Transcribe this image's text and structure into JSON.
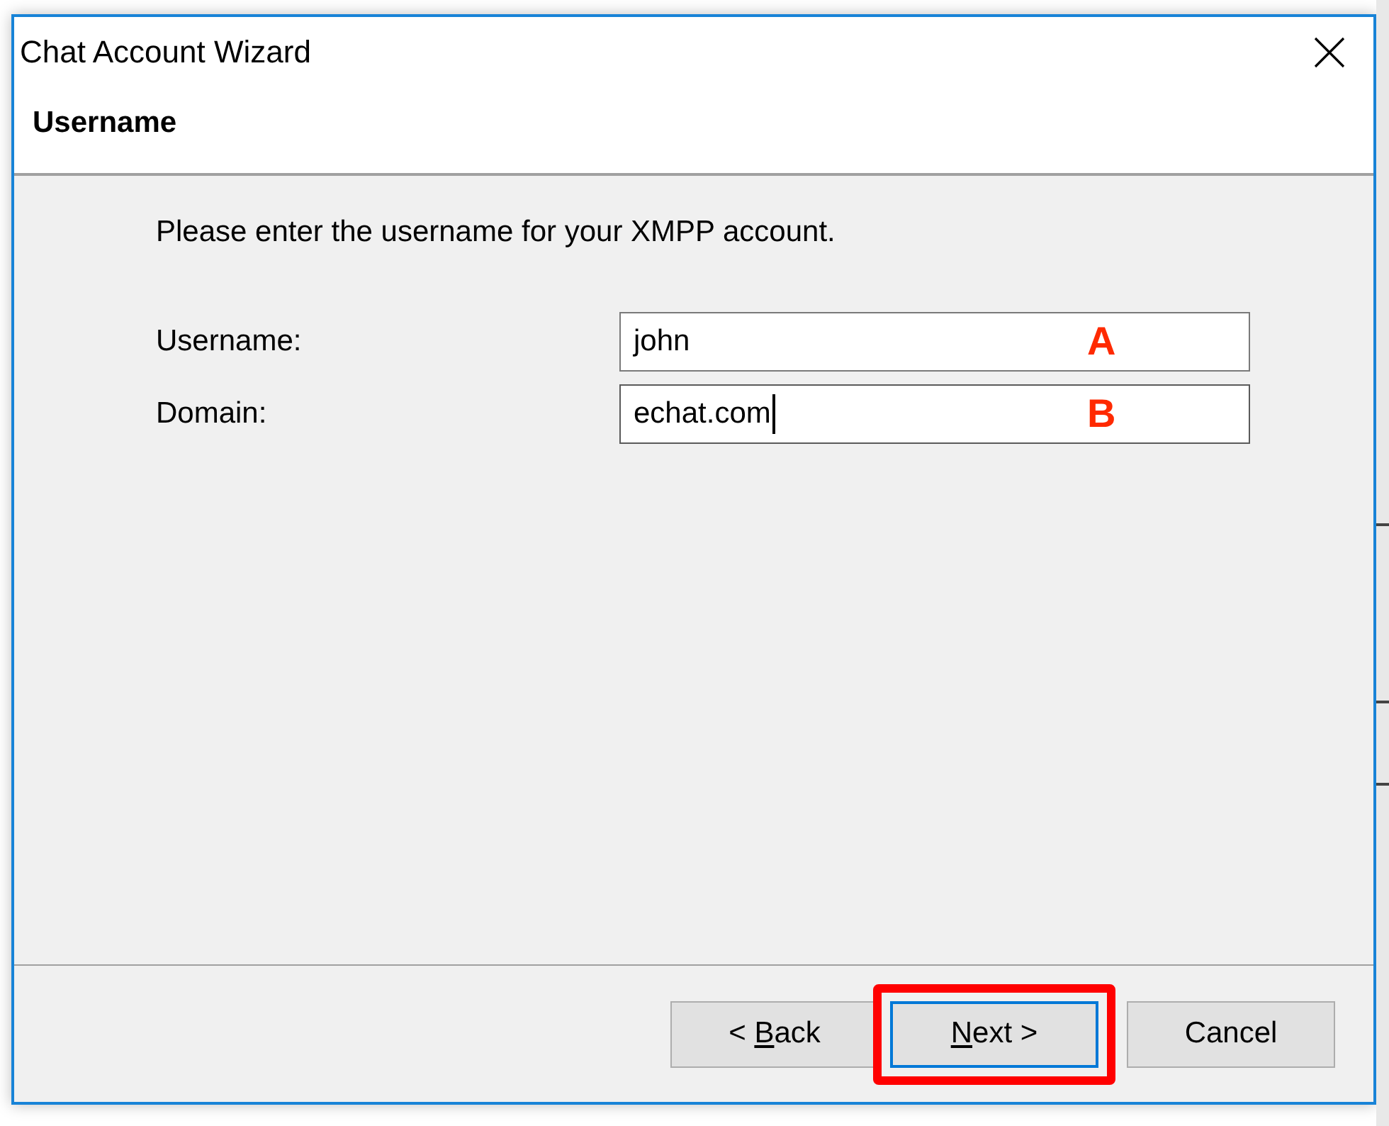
{
  "window": {
    "title": "Chat Account Wizard"
  },
  "page_heading": "Username",
  "instruction": "Please enter the username for your XMPP account.",
  "fields": [
    {
      "label": "Username:",
      "value": "john",
      "focused": false,
      "annotation": "A"
    },
    {
      "label": "Domain:",
      "value": "echat.com",
      "focused": true,
      "annotation": "B"
    }
  ],
  "buttons": [
    {
      "before": "< ",
      "mnemonic": "B",
      "after": "ack",
      "default": false,
      "highlighted": false
    },
    {
      "mnemonic": "N",
      "after": "ext >",
      "default": true,
      "highlighted": true
    },
    {
      "before": "Cancel",
      "default": false,
      "highlighted": false
    }
  ]
}
